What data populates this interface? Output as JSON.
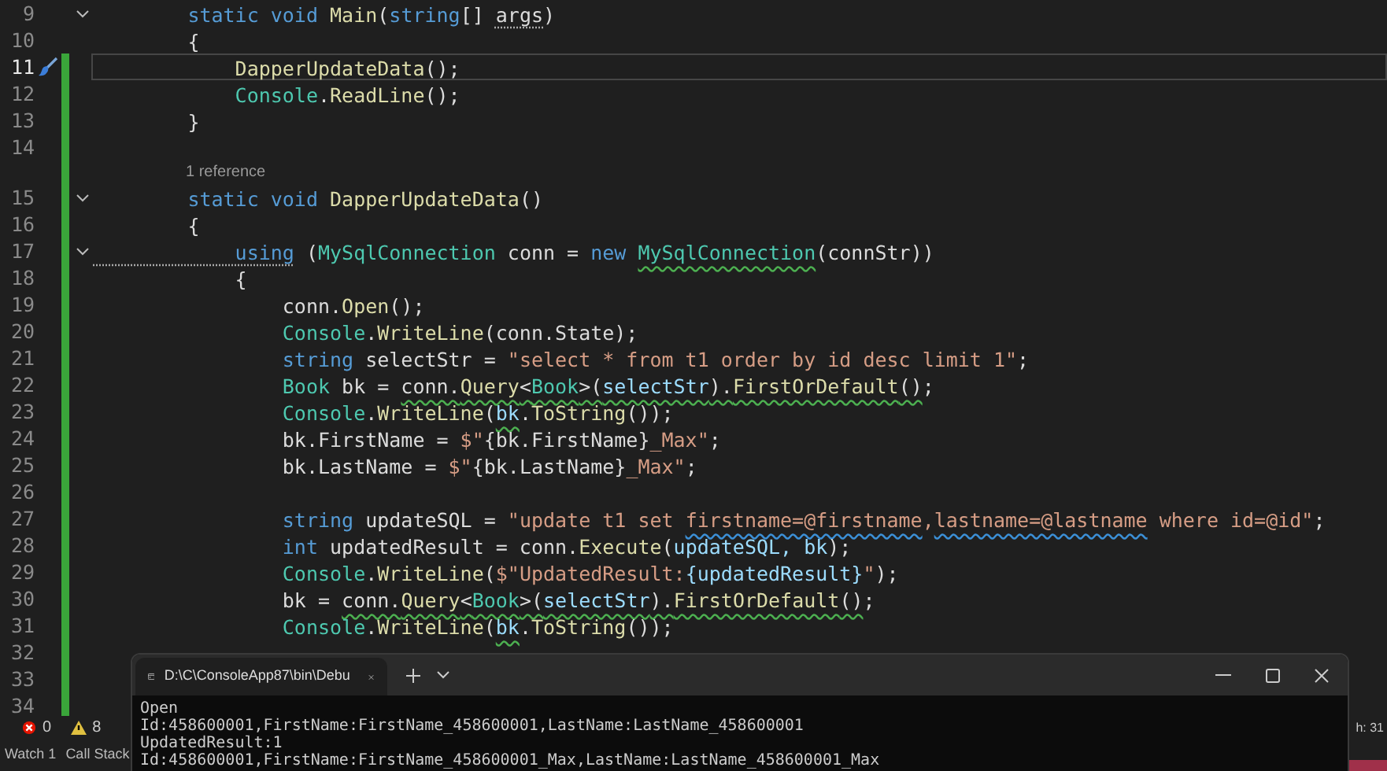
{
  "editor": {
    "lines": [
      {
        "number": "9",
        "current": false,
        "changed": false,
        "foldable": true,
        "tokens": [
          {
            "text": "        static",
            "kind": "keyword"
          },
          {
            "text": " void",
            "kind": "keyword"
          },
          {
            "text": " Main",
            "kind": "method"
          },
          {
            "text": "(",
            "kind": "plain"
          },
          {
            "text": "string",
            "kind": "keyword"
          },
          {
            "text": "[] ",
            "kind": "plain"
          },
          {
            "text": "args",
            "kind": "plain",
            "hint": true
          },
          {
            "text": ")",
            "kind": "plain"
          }
        ]
      },
      {
        "number": "10",
        "current": false,
        "changed": false,
        "foldable": false,
        "tokens": [
          {
            "text": "        {",
            "kind": "plain"
          }
        ]
      },
      {
        "number": "11",
        "current": true,
        "changed": true,
        "foldable": false,
        "tokens": [
          {
            "text": "            DapperUpdateData",
            "kind": "method"
          },
          {
            "text": "();",
            "kind": "plain"
          }
        ]
      },
      {
        "number": "12",
        "current": false,
        "changed": true,
        "foldable": false,
        "tokens": [
          {
            "text": "            Console",
            "kind": "type"
          },
          {
            "text": ".",
            "kind": "plain"
          },
          {
            "text": "ReadLine",
            "kind": "method"
          },
          {
            "text": "();",
            "kind": "plain"
          }
        ]
      },
      {
        "number": "13",
        "current": false,
        "changed": true,
        "foldable": false,
        "tokens": [
          {
            "text": "        }",
            "kind": "plain"
          }
        ]
      },
      {
        "number": "14",
        "current": false,
        "changed": true,
        "foldable": false
      },
      {
        "number": "15",
        "current": false,
        "changed": true,
        "foldable": true,
        "codelens": "1 reference",
        "tokens": [
          {
            "text": "        static",
            "kind": "keyword"
          },
          {
            "text": " void",
            "kind": "keyword"
          },
          {
            "text": " DapperUpdateData",
            "kind": "method"
          },
          {
            "text": "()",
            "kind": "plain"
          }
        ]
      },
      {
        "number": "16",
        "current": false,
        "changed": true,
        "foldable": false,
        "tokens": [
          {
            "text": "        {",
            "kind": "plain"
          }
        ]
      },
      {
        "number": "17",
        "current": false,
        "changed": true,
        "foldable": true,
        "tokens": [
          {
            "text": "            using",
            "kind": "keyword",
            "hint": true
          },
          {
            "text": " (",
            "kind": "plain"
          },
          {
            "text": "MySqlConnection",
            "kind": "type"
          },
          {
            "text": " conn = ",
            "kind": "plain"
          },
          {
            "text": "new ",
            "kind": "keyword"
          },
          {
            "text": "MySqlConnection",
            "kind": "type",
            "warning": true
          },
          {
            "text": "(connStr))",
            "kind": "plain"
          }
        ]
      },
      {
        "number": "18",
        "current": false,
        "changed": true,
        "foldable": false,
        "tokens": [
          {
            "text": "            {",
            "kind": "plain"
          }
        ]
      },
      {
        "number": "19",
        "current": false,
        "changed": true,
        "foldable": false,
        "tokens": [
          {
            "text": "                conn.",
            "kind": "plain"
          },
          {
            "text": "Open",
            "kind": "method"
          },
          {
            "text": "();",
            "kind": "plain"
          }
        ]
      },
      {
        "number": "20",
        "current": false,
        "changed": true,
        "foldable": false,
        "tokens": [
          {
            "text": "                Console",
            "kind": "type"
          },
          {
            "text": ".",
            "kind": "plain"
          },
          {
            "text": "WriteLine",
            "kind": "method"
          },
          {
            "text": "(conn.State);",
            "kind": "plain"
          }
        ]
      },
      {
        "number": "21",
        "current": false,
        "changed": true,
        "foldable": false,
        "tokens": [
          {
            "text": "                string",
            "kind": "keyword"
          },
          {
            "text": " selectStr = ",
            "kind": "plain"
          },
          {
            "text": "\"select * from t1 order by id desc limit 1\"",
            "kind": "string"
          },
          {
            "text": ";",
            "kind": "plain"
          }
        ]
      },
      {
        "number": "22",
        "current": false,
        "changed": true,
        "foldable": false,
        "tokens": [
          {
            "text": "                Book",
            "kind": "type"
          },
          {
            "text": " bk = ",
            "kind": "plain"
          },
          {
            "text": "conn.",
            "kind": "plain",
            "warning": true
          },
          {
            "text": "Query",
            "kind": "method",
            "warning": true
          },
          {
            "text": "<",
            "kind": "plain",
            "warning": true
          },
          {
            "text": "Book",
            "kind": "type",
            "warning": true
          },
          {
            "text": ">(",
            "kind": "plain",
            "warning": true
          },
          {
            "text": "selectStr",
            "kind": "variable",
            "warning": true
          },
          {
            "text": ").",
            "kind": "plain",
            "warning": true
          },
          {
            "text": "FirstOrDefault",
            "kind": "method",
            "warning": true
          },
          {
            "text": "()",
            "kind": "plain",
            "warning": true
          },
          {
            "text": ";",
            "kind": "plain"
          }
        ]
      },
      {
        "number": "23",
        "current": false,
        "changed": true,
        "foldable": false,
        "tokens": [
          {
            "text": "                Console",
            "kind": "type"
          },
          {
            "text": ".",
            "kind": "plain"
          },
          {
            "text": "WriteLine",
            "kind": "method"
          },
          {
            "text": "(",
            "kind": "plain"
          },
          {
            "text": "bk",
            "kind": "variable",
            "warning": true
          },
          {
            "text": ".",
            "kind": "plain"
          },
          {
            "text": "ToString",
            "kind": "method"
          },
          {
            "text": "());",
            "kind": "plain"
          }
        ]
      },
      {
        "number": "24",
        "current": false,
        "changed": true,
        "foldable": false,
        "tokens": [
          {
            "text": "                bk.FirstName = ",
            "kind": "plain"
          },
          {
            "text": "$\"",
            "kind": "string"
          },
          {
            "text": "{bk.FirstName}",
            "kind": "plain"
          },
          {
            "text": "_Max\"",
            "kind": "string"
          },
          {
            "text": ";",
            "kind": "plain"
          }
        ]
      },
      {
        "number": "25",
        "current": false,
        "changed": true,
        "foldable": false,
        "tokens": [
          {
            "text": "                bk.LastName = ",
            "kind": "plain"
          },
          {
            "text": "$\"",
            "kind": "string"
          },
          {
            "text": "{bk.LastName}",
            "kind": "plain"
          },
          {
            "text": "_Max\"",
            "kind": "string"
          },
          {
            "text": ";",
            "kind": "plain"
          }
        ]
      },
      {
        "number": "26",
        "current": false,
        "changed": true,
        "foldable": false
      },
      {
        "number": "27",
        "current": false,
        "changed": true,
        "foldable": false,
        "tokens": [
          {
            "text": "                string",
            "kind": "keyword"
          },
          {
            "text": " updateSQL = ",
            "kind": "plain"
          },
          {
            "text": "\"update t1 set ",
            "kind": "string"
          },
          {
            "text": "firstname=@firstname",
            "kind": "string",
            "info": true
          },
          {
            "text": ",",
            "kind": "string"
          },
          {
            "text": "lastname=@lastname",
            "kind": "string",
            "info": true
          },
          {
            "text": " where id=@id\"",
            "kind": "string"
          },
          {
            "text": ";",
            "kind": "plain"
          }
        ]
      },
      {
        "number": "28",
        "current": false,
        "changed": true,
        "foldable": false,
        "tokens": [
          {
            "text": "                int",
            "kind": "keyword"
          },
          {
            "text": " updatedResult = conn.",
            "kind": "plain"
          },
          {
            "text": "Execute",
            "kind": "method"
          },
          {
            "text": "(",
            "kind": "plain"
          },
          {
            "text": "updateSQL, bk",
            "kind": "variable"
          },
          {
            "text": ");",
            "kind": "plain"
          }
        ]
      },
      {
        "number": "29",
        "current": false,
        "changed": true,
        "foldable": false,
        "tokens": [
          {
            "text": "                Console",
            "kind": "type"
          },
          {
            "text": ".",
            "kind": "plain"
          },
          {
            "text": "WriteLine",
            "kind": "method"
          },
          {
            "text": "(",
            "kind": "plain"
          },
          {
            "text": "$\"UpdatedResult:",
            "kind": "string"
          },
          {
            "text": "{updatedResult}",
            "kind": "variable"
          },
          {
            "text": "\"",
            "kind": "string"
          },
          {
            "text": ");",
            "kind": "plain"
          }
        ]
      },
      {
        "number": "30",
        "current": false,
        "changed": true,
        "foldable": false,
        "tokens": [
          {
            "text": "                bk = ",
            "kind": "plain"
          },
          {
            "text": "conn.",
            "kind": "plain",
            "warning": true
          },
          {
            "text": "Query",
            "kind": "method",
            "warning": true
          },
          {
            "text": "<",
            "kind": "plain",
            "warning": true
          },
          {
            "text": "Book",
            "kind": "type",
            "warning": true
          },
          {
            "text": ">(",
            "kind": "plain",
            "warning": true
          },
          {
            "text": "selectStr",
            "kind": "variable",
            "warning": true
          },
          {
            "text": ").",
            "kind": "plain",
            "warning": true
          },
          {
            "text": "FirstOrDefault",
            "kind": "method",
            "warning": true
          },
          {
            "text": "()",
            "kind": "plain",
            "warning": true
          },
          {
            "text": ";",
            "kind": "plain"
          }
        ]
      },
      {
        "number": "31",
        "current": false,
        "changed": true,
        "foldable": false,
        "tokens": [
          {
            "text": "                Console",
            "kind": "type"
          },
          {
            "text": ".",
            "kind": "plain"
          },
          {
            "text": "WriteLine",
            "kind": "method"
          },
          {
            "text": "(",
            "kind": "plain"
          },
          {
            "text": "bk",
            "kind": "variable",
            "warning": true
          },
          {
            "text": ".",
            "kind": "plain"
          },
          {
            "text": "ToString",
            "kind": "method"
          },
          {
            "text": "());",
            "kind": "plain"
          }
        ]
      },
      {
        "number": "32",
        "current": false,
        "changed": true,
        "foldable": false
      },
      {
        "number": "33",
        "current": false,
        "changed": true,
        "foldable": false
      },
      {
        "number": "34",
        "current": false,
        "changed": true,
        "foldable": false
      }
    ]
  },
  "status_bar": {
    "errors": "0",
    "warnings": "8",
    "position": "h: 31"
  },
  "bottom_tabs": [
    {
      "label": "Watch 1"
    },
    {
      "label": "Call Stack"
    }
  ],
  "console": {
    "tab_title": "D:\\C\\ConsoleApp87\\bin\\Debu",
    "output": [
      "Open",
      "Id:458600001,FirstName:FirstName_458600001,LastName:LastName_458600001",
      "UpdatedResult:1",
      "Id:458600001,FirstName:FirstName_458600001_Max,LastName:LastName_458600001_Max"
    ]
  }
}
